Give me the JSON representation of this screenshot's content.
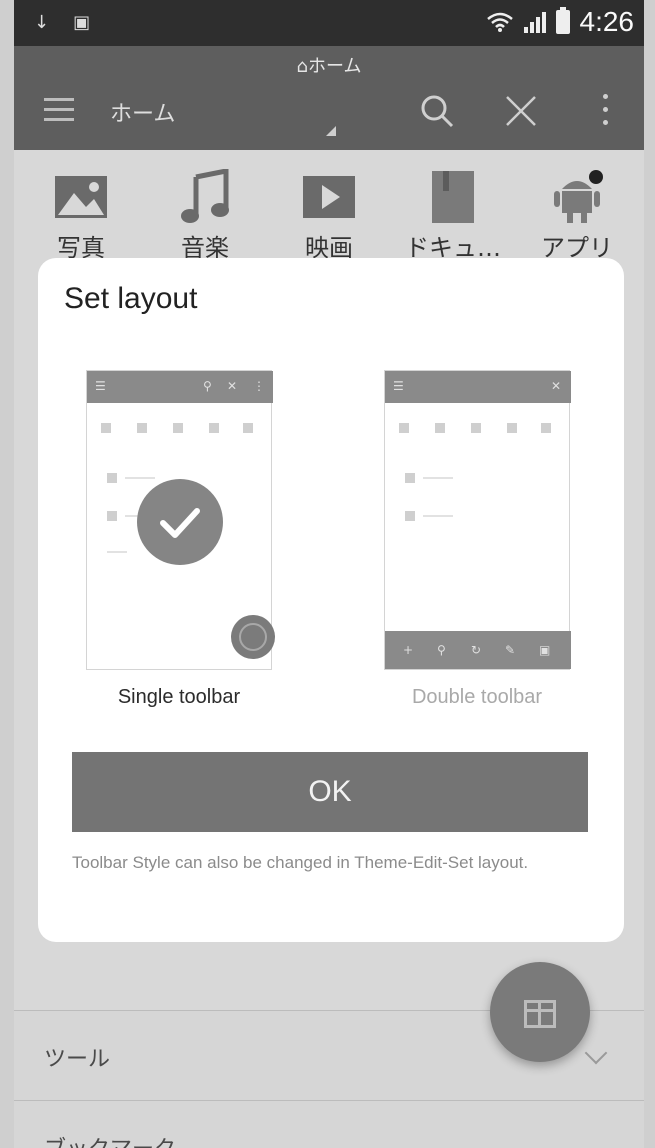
{
  "status_bar": {
    "time": "4:26",
    "left_icons": [
      "download-icon",
      "image-icon"
    ],
    "right_icons": [
      "wifi-icon",
      "signal-icon",
      "battery-icon"
    ]
  },
  "header": {
    "sub_title": "ホーム",
    "title": "ホーム"
  },
  "categories": [
    {
      "label": "写真",
      "icon": "photo-icon"
    },
    {
      "label": "音楽",
      "icon": "music-icon"
    },
    {
      "label": "映画",
      "icon": "video-icon"
    },
    {
      "label": "ドキュ…",
      "icon": "document-icon"
    },
    {
      "label": "アプリ",
      "icon": "android-icon"
    }
  ],
  "rows": [
    {
      "label": "ツール"
    },
    {
      "label": "ブックマーク"
    }
  ],
  "dialog": {
    "title": "Set layout",
    "options": [
      {
        "label": "Single toolbar",
        "selected": true
      },
      {
        "label": "Double toolbar",
        "selected": false
      }
    ],
    "ok_label": "OK",
    "note": "Toolbar Style can also be changed in Theme-Edit-Set layout."
  },
  "colors": {
    "dialog_bg": "#ffffff",
    "button": "#747474",
    "overlay": "#d8d8d8",
    "header": "#5e5e5e"
  }
}
